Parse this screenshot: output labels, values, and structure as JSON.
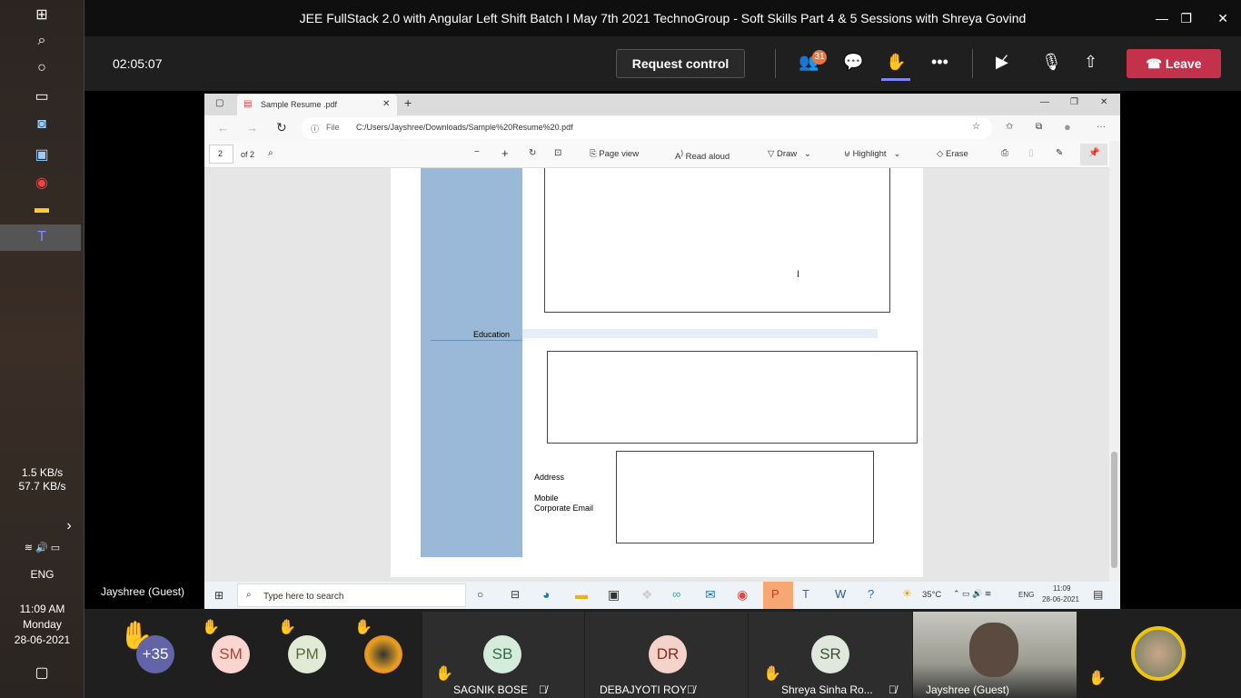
{
  "windows_sidebar": {
    "net_up": "1.5 KB/s",
    "net_down": "57.7 KB/s",
    "lang": "ENG",
    "time": "11:09 AM",
    "day": "Monday",
    "date": "28-06-2021"
  },
  "teams": {
    "title": "JEE FullStack 2.0 with Angular Left Shift Batch I May 7th 2021 TechnoGroup - Soft Skills Part 4 & 5 Sessions with Shreya Govind",
    "timer": "02:05:07",
    "request_control": "Request control",
    "participants_badge": "31",
    "leave": "Leave",
    "presenter_label": "Jayshree (Guest)",
    "leave_color": "#c4314b"
  },
  "edge": {
    "tab_title": "Sample Resume .pdf",
    "url_prefix": "File",
    "url": "C:/Users/Jayshree/Downloads/Sample%20Resume%20.pdf",
    "page_num": "2",
    "page_of": "of 2",
    "toolbar": {
      "page_view": "Page view",
      "read_aloud": "Read aloud",
      "draw": "Draw",
      "highlight": "Highlight",
      "erase": "Erase"
    }
  },
  "pdf": {
    "education": "Education",
    "address": "Address",
    "mobile": "Mobile",
    "email": "Corporate Email",
    "sidebar_color": "#9ab8d7"
  },
  "shared_taskbar": {
    "search_placeholder": "Type here to search",
    "weather": "35°C",
    "lang": "ENG",
    "time": "11:09",
    "date": "28-06-2021"
  },
  "participants": [
    {
      "initials": "+35"
    },
    {
      "initials": "SM"
    },
    {
      "initials": "PM"
    },
    {
      "initials": "SB",
      "name": "SAGNIK BOSE"
    },
    {
      "initials": "DR",
      "name": "DEBAJYOTI ROY"
    },
    {
      "initials": "SR",
      "name": "Shreya Sinha Ro..."
    },
    {
      "name": "Jayshree (Guest)"
    }
  ]
}
